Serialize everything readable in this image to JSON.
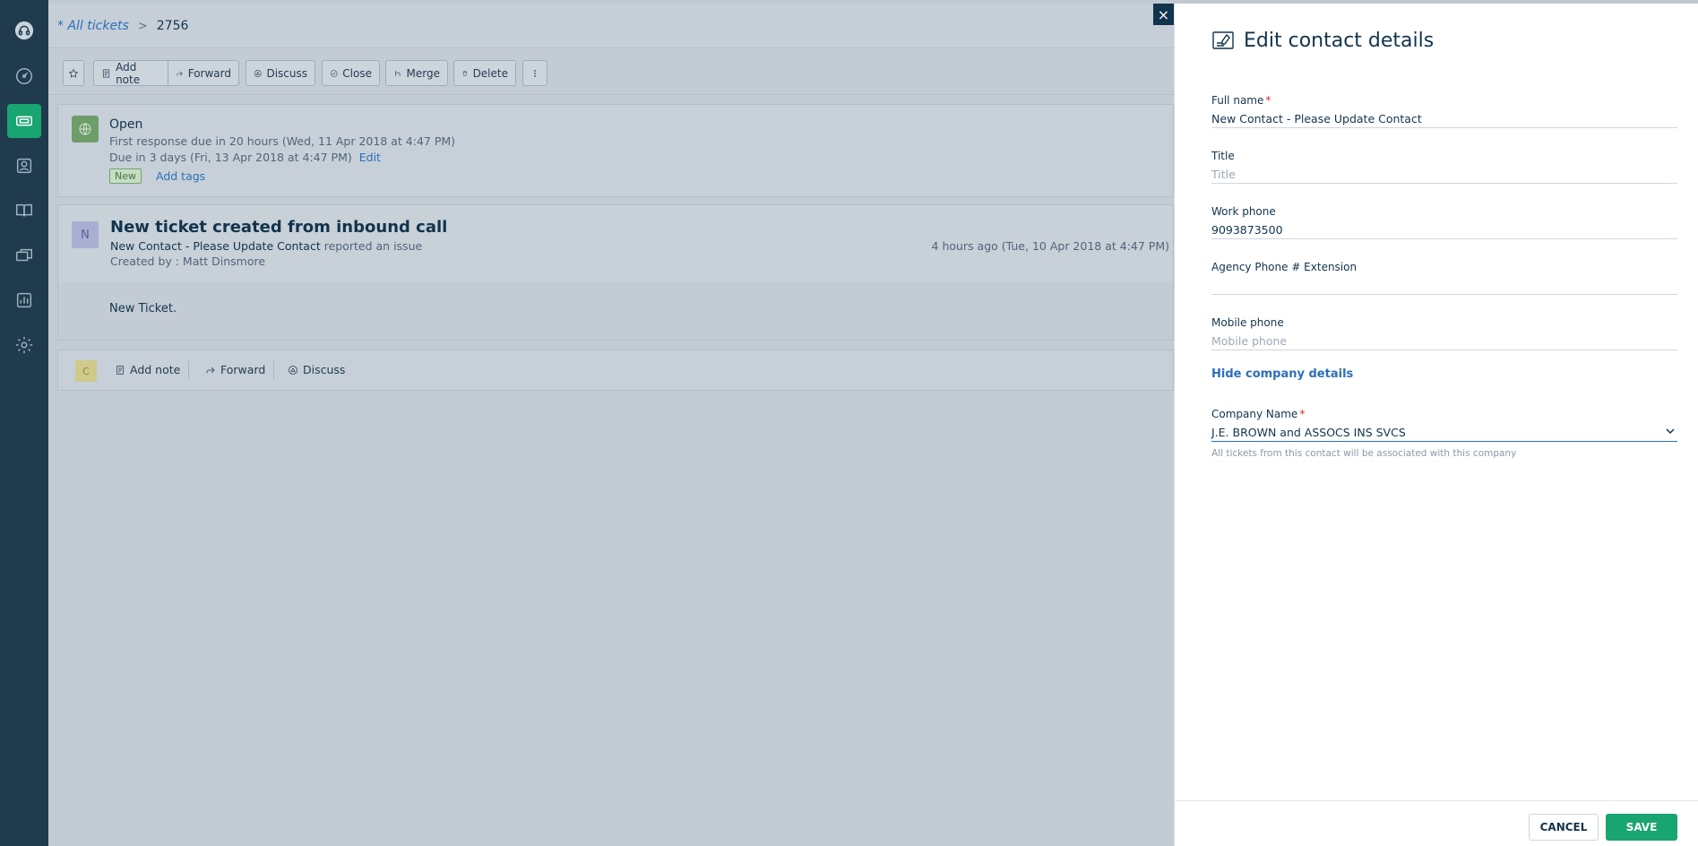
{
  "nav": {
    "items": [
      {
        "icon": "headset-logo-icon"
      },
      {
        "icon": "dashboard-icon"
      },
      {
        "icon": "tickets-icon",
        "active": true
      },
      {
        "icon": "contacts-icon"
      },
      {
        "icon": "solutions-book-icon"
      },
      {
        "icon": "discussions-icon"
      },
      {
        "icon": "reports-icon"
      },
      {
        "icon": "settings-gear-icon"
      }
    ]
  },
  "breadcrumb": {
    "all_tickets": "* All tickets",
    "separator": ">",
    "ticket_id": "2756"
  },
  "toolbar": {
    "add_note": "Add note",
    "forward": "Forward",
    "discuss": "Discuss",
    "close": "Close",
    "merge": "Merge",
    "delete": "Delete"
  },
  "status": {
    "state": "Open",
    "first_response": "First response due in 20 hours (Wed, 11 Apr 2018 at 4:47 PM)",
    "due": "Due in 3 days (Fri, 13 Apr 2018 at 4:47 PM)",
    "edit": "Edit",
    "tag": "New",
    "add_tags": "Add tags"
  },
  "ticket": {
    "avatar_letter": "N",
    "title": "New ticket created from inbound call",
    "reporter": "New Contact - Please Update Contact",
    "reported_text": "reported an issue",
    "created_by": "Created by : Matt Dinsmore",
    "time": "4 hours ago (Tue, 10 Apr 2018 at 4:47 PM)",
    "body": "New Ticket."
  },
  "reply": {
    "avatar_letter": "C",
    "add_note": "Add note",
    "forward": "Forward",
    "discuss": "Discuss"
  },
  "drawer": {
    "close": "×",
    "title": "Edit contact details",
    "full_name": {
      "label": "Full name",
      "value": "New Contact - Please Update Contact"
    },
    "title_field": {
      "label": "Title",
      "placeholder": "Title",
      "value": ""
    },
    "work_phone": {
      "label": "Work phone",
      "value": "9093873500"
    },
    "agency_ext": {
      "label": "Agency Phone # Extension",
      "value": ""
    },
    "mobile_phone": {
      "label": "Mobile phone",
      "placeholder": "Mobile phone",
      "value": ""
    },
    "hide_company": "Hide company details",
    "company": {
      "label": "Company Name",
      "value": "J.E. BROWN and ASSOCS INS SVCS",
      "help": "All tickets from this contact will be associated with this company"
    },
    "required_mark": "*",
    "cancel": "CANCEL",
    "save": "SAVE"
  },
  "colors": {
    "accent_green": "#19a572",
    "link_blue": "#2c6fb8",
    "nav_bg": "#1f3b4d",
    "required_red": "#d72d30"
  }
}
